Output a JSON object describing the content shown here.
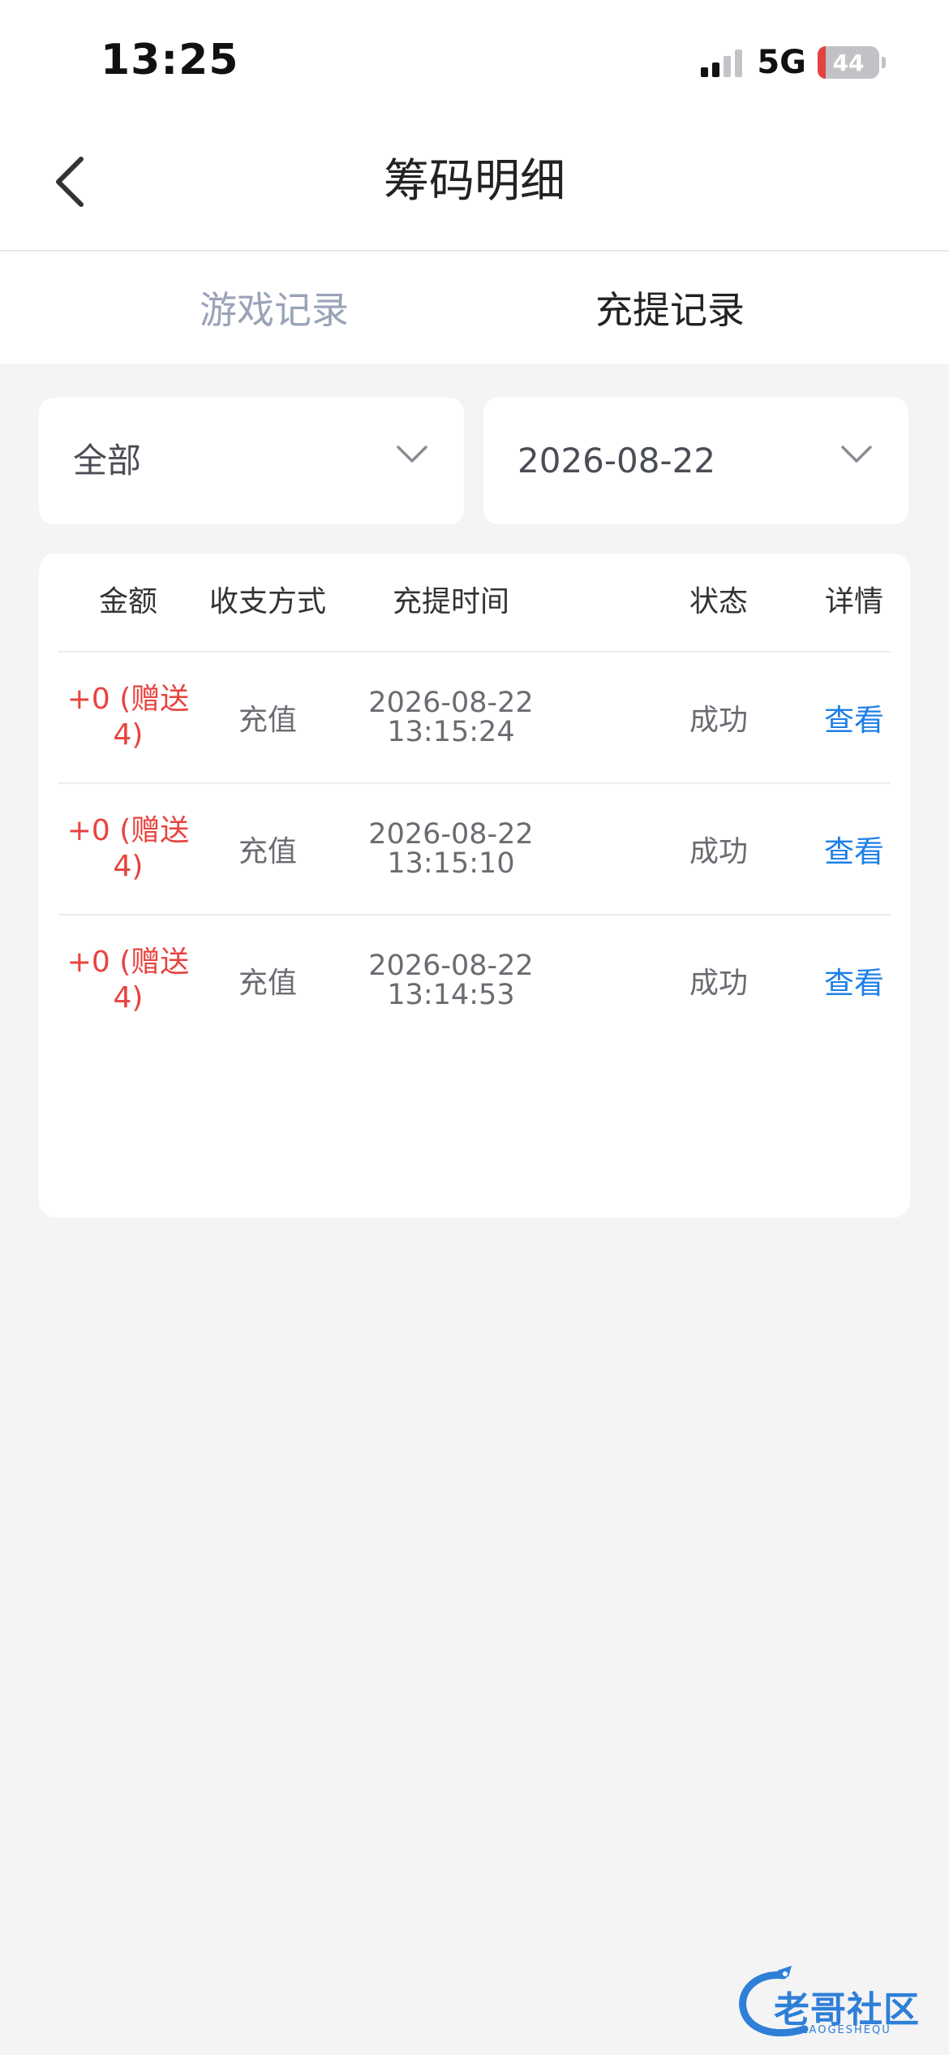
{
  "status_bar": {
    "time": "13:25",
    "network": "5G",
    "battery": "44",
    "battery_level": 0.13
  },
  "nav": {
    "title": "筹码明细",
    "back_icon": "chevron-left-icon"
  },
  "tabs": [
    {
      "label": "游戏记录",
      "active": false
    },
    {
      "label": "充提记录",
      "active": true
    }
  ],
  "filters": {
    "type": "全部",
    "date": "2026-08-22"
  },
  "table": {
    "headers": [
      "金额",
      "收支方式",
      "充提时间",
      "状态",
      "详情"
    ],
    "rows": [
      {
        "amount_line1": "+0 (赠送",
        "amount_line2": "4)",
        "method": "充值",
        "date": "2026-08-22",
        "time": "13:15:24",
        "status": "成功",
        "detail": "查看"
      },
      {
        "amount_line1": "+0 (赠送",
        "amount_line2": "4)",
        "method": "充值",
        "date": "2026-08-22",
        "time": "13:15:10",
        "status": "成功",
        "detail": "查看"
      },
      {
        "amount_line1": "+0 (赠送",
        "amount_line2": "4)",
        "method": "充值",
        "date": "2026-08-22",
        "time": "13:14:53",
        "status": "成功",
        "detail": "查看"
      }
    ]
  },
  "watermark": {
    "text": "老哥社区",
    "sub": "LAOGESHEQU"
  },
  "colors": {
    "amount": "#e8433f",
    "link": "#1e7fe8",
    "tab_inactive": "#9aa3b8",
    "background": "#f4f4f5"
  }
}
